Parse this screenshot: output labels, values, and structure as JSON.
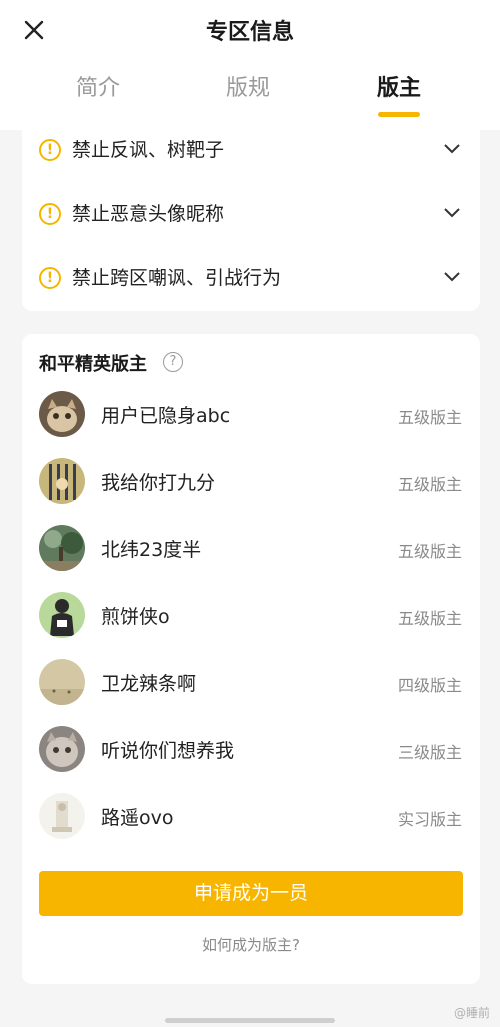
{
  "header": {
    "title": "专区信息",
    "tabs": [
      {
        "label": "简介"
      },
      {
        "label": "版规"
      },
      {
        "label": "版主"
      }
    ],
    "active_tab": "版主"
  },
  "rules": [
    {
      "text": "禁止反讽、树靶子"
    },
    {
      "text": "禁止恶意头像昵称"
    },
    {
      "text": "禁止跨区嘲讽、引战行为"
    }
  ],
  "moderators": {
    "heading": "和平精英版主",
    "list": [
      {
        "name": "用户已隐身abc",
        "level": "五级版主"
      },
      {
        "name": "我给你打九分",
        "level": "五级版主"
      },
      {
        "name": "北纬23度半",
        "level": "五级版主"
      },
      {
        "name": "煎饼侠o",
        "level": "五级版主"
      },
      {
        "name": "卫龙辣条啊",
        "level": "四级版主"
      },
      {
        "name": "听说你们想养我",
        "level": "三级版主"
      },
      {
        "name": "路遥ovo",
        "level": "实习版主"
      }
    ],
    "join_label": "申请成为一员",
    "how_label": "如何成为版主?"
  },
  "colors": {
    "accent": "#f7b500",
    "muted_text": "#8a8a8a",
    "background": "#f5f5f5"
  },
  "watermark": "@睡前"
}
